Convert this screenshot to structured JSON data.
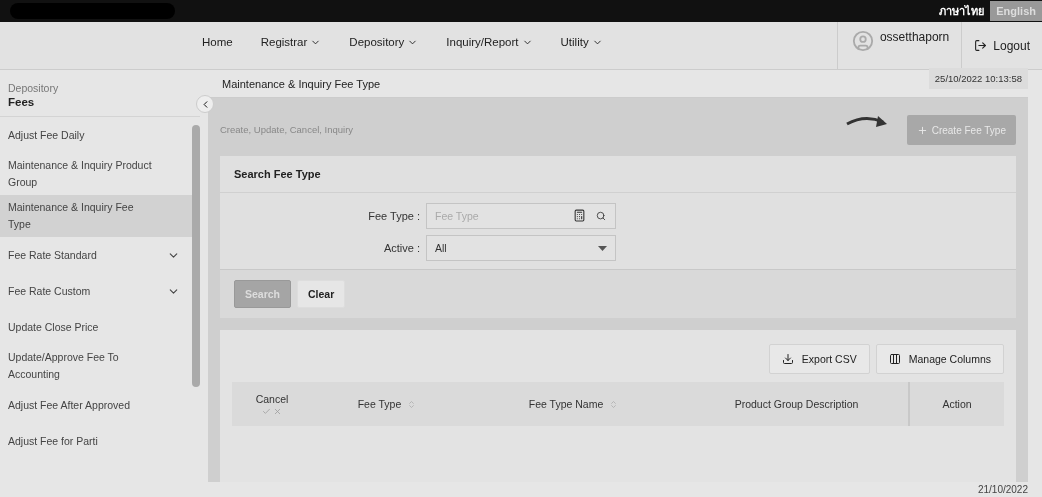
{
  "top_bar": {
    "languages": [
      {
        "label": "ภาษาไทย",
        "selected": false
      },
      {
        "label": "English",
        "selected": true
      }
    ]
  },
  "nav": {
    "items": [
      {
        "label": "Home",
        "has_menu": false
      },
      {
        "label": "Registrar",
        "has_menu": true
      },
      {
        "label": "Depository",
        "has_menu": true
      },
      {
        "label": "Inquiry/Report",
        "has_menu": true
      },
      {
        "label": "Utility",
        "has_menu": true
      }
    ],
    "user": "ossetthaporn",
    "logout": "Logout"
  },
  "sidebar": {
    "breadcrumb": "Depository",
    "section": "Fees",
    "items": [
      {
        "label": "Adjust Fee Daily",
        "selected": false,
        "expandable": false
      },
      {
        "label": "Maintenance & Inquiry Product Group",
        "selected": false,
        "expandable": false
      },
      {
        "label": "Maintenance & Inquiry Fee Type",
        "selected": true,
        "expandable": false
      },
      {
        "label": "Fee Rate Standard",
        "selected": false,
        "expandable": true
      },
      {
        "label": "Fee Rate Custom",
        "selected": false,
        "expandable": true
      },
      {
        "label": "Update Close Price",
        "selected": false,
        "expandable": false
      },
      {
        "label": "Update/Approve Fee To Accounting",
        "selected": false,
        "expandable": false
      },
      {
        "label": "Adjust Fee After Approved",
        "selected": false,
        "expandable": false
      },
      {
        "label": "Adjust Fee for Parti",
        "selected": false,
        "expandable": false
      }
    ]
  },
  "page": {
    "title": "Maintenance & Inquiry Fee Type",
    "timestamp": "25/10/2022 10:13:58",
    "subtitle": "Create, Update, Cancel, Inquiry",
    "create_button": {
      "label": "Create Fee Type",
      "disabled": true
    }
  },
  "search": {
    "title": "Search Fee Type",
    "fields": [
      {
        "kind": "text",
        "label": "Fee Type :",
        "placeholder": "Fee Type"
      },
      {
        "kind": "select",
        "label": "Active :",
        "value": "All"
      }
    ],
    "buttons": [
      {
        "label": "Search",
        "kind": "primary",
        "disabled": true
      },
      {
        "label": "Clear",
        "kind": "secondary",
        "disabled": false
      }
    ]
  },
  "table": {
    "actions": [
      {
        "label": "Export CSV",
        "kind": "export"
      },
      {
        "label": "Manage Columns",
        "kind": "columns"
      }
    ],
    "columns": [
      {
        "label": "Cancel",
        "kind": "cancel",
        "sortable": false
      },
      {
        "label": "Fee Type",
        "kind": "text",
        "sortable": true
      },
      {
        "label": "Fee Type Name",
        "kind": "text",
        "sortable": true
      },
      {
        "label": "Product Group Description",
        "kind": "text",
        "sortable": false
      },
      {
        "label": "Action",
        "kind": "action",
        "sortable": false
      }
    ]
  },
  "footer_date": "21/10/2022"
}
